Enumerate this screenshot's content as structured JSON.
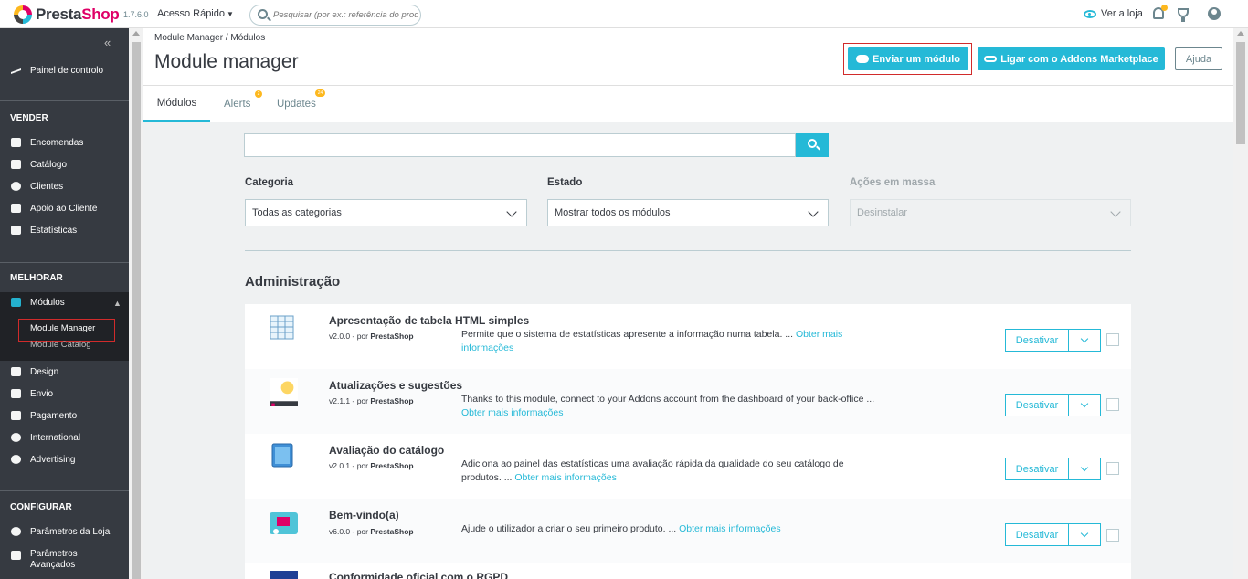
{
  "topbar": {
    "logo_a": "Presta",
    "logo_b": "Shop",
    "version": "1.7.6.0",
    "quick_access": "Acesso Rápido",
    "search_placeholder": "Pesquisar (por ex.: referência do produt",
    "view_shop": "Ver a loja"
  },
  "sidebar": {
    "dashboard": "Painel de controlo",
    "sec_sell": "VENDER",
    "orders": "Encomendas",
    "catalog": "Catálogo",
    "customers": "Clientes",
    "support": "Apoio ao Cliente",
    "stats": "Estatísticas",
    "sec_improve": "MELHORAR",
    "modules": "Módulos",
    "module_manager": "Module Manager",
    "module_catalog": "Module Catalog",
    "design": "Design",
    "shipping": "Envio",
    "payment": "Pagamento",
    "international": "International",
    "advertising": "Advertising",
    "sec_config": "CONFIGURAR",
    "shop_params": "Parâmetros da Loja",
    "adv_params_1": "Parâmetros",
    "adv_params_2": "Avançados"
  },
  "header": {
    "crumb_1": "Module Manager",
    "crumb_sep": "/",
    "crumb_2": "Módulos",
    "title": "Module manager",
    "upload_btn": "Enviar um módulo",
    "addons_btn": "Ligar com o Addons Marketplace",
    "help_btn": "Ajuda"
  },
  "tabs": {
    "modules": "Módulos",
    "alerts": "Alerts",
    "alerts_badge": "2",
    "updates": "Updates",
    "updates_badge": "24"
  },
  "filters": {
    "category_label": "Categoria",
    "category_value": "Todas as categorias",
    "status_label": "Estado",
    "status_value": "Mostrar todos os módulos",
    "bulk_label": "Ações em massa",
    "bulk_value": "Desinstalar"
  },
  "category_title": "Administração",
  "modules": [
    {
      "name": "Apresentação de tabela HTML simples",
      "version": "v2.0.0 - por",
      "author": "PrestaShop",
      "desc": "Permite que o sistema de estatísticas apresente a informação numa tabela. ...",
      "more": "Obter mais informações",
      "action": "Desativar"
    },
    {
      "name": "Atualizações e sugestões",
      "version": "v2.1.1 - por",
      "author": "PrestaShop",
      "desc": "Thanks to this module, connect to your Addons account from the dashboard of your back-office ...",
      "more": "Obter mais informações",
      "action": "Desativar"
    },
    {
      "name": "Avaliação do catálogo",
      "version": "v2.0.1 - por",
      "author": "PrestaShop",
      "desc": "Adiciona ao painel das estatísticas uma avaliação rápida da qualidade do seu catálogo de produtos. ...",
      "more": "Obter mais informações",
      "action": "Desativar"
    },
    {
      "name": "Bem-vindo(a)",
      "version": "v6.0.0 - por",
      "author": "PrestaShop",
      "desc": "Ajude o utilizador a criar o seu primeiro produto. ...",
      "more": "Obter mais informações",
      "action": "Desativar"
    },
    {
      "name": "Conformidade oficial com o RGPD"
    }
  ],
  "colors": {
    "accent": "#25b9d7",
    "sidebar": "#363a41",
    "badge": "#fdb81e",
    "highlight": "#d12b2b"
  }
}
